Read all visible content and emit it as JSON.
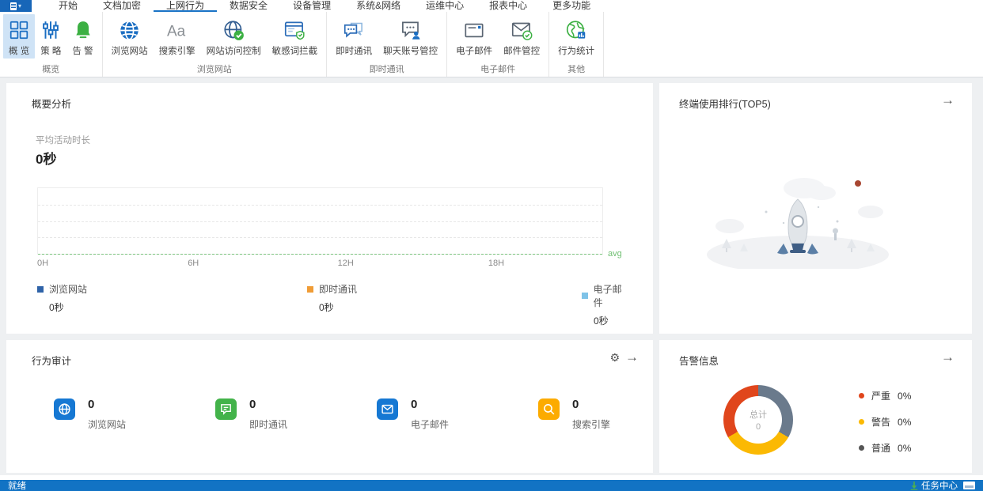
{
  "window": {
    "app_menu_caret": "▾",
    "tabs": {
      "items": [
        "开始",
        "文档加密",
        "上网行为",
        "数据安全",
        "设备管理",
        "系统&网络",
        "运维中心",
        "报表中心",
        "更多功能"
      ],
      "active": "上网行为"
    }
  },
  "ribbon": {
    "groups": [
      {
        "label": "概览",
        "items": [
          {
            "label": "概 览",
            "selected": true
          },
          {
            "label": "策 略"
          },
          {
            "label": "告 警"
          }
        ]
      },
      {
        "label": "浏览网站",
        "items": [
          {
            "label": "浏览网站"
          },
          {
            "label": "搜索引擎"
          },
          {
            "label": "网站访问控制"
          },
          {
            "label": "敏感词拦截"
          }
        ]
      },
      {
        "label": "即时通讯",
        "items": [
          {
            "label": "即时通讯"
          },
          {
            "label": "聊天账号管控"
          }
        ]
      },
      {
        "label": "电子邮件",
        "items": [
          {
            "label": "电子邮件"
          },
          {
            "label": "邮件管控"
          }
        ]
      },
      {
        "label": "其他",
        "items": [
          {
            "label": "行为统计"
          }
        ]
      }
    ]
  },
  "panels": {
    "summary": {
      "title": "概要分析",
      "metric_label": "平均活动时长",
      "metric_value": "0秒",
      "x_ticks": [
        "0H",
        "6H",
        "12H",
        "18H"
      ],
      "avg_label": "avg",
      "legend": [
        {
          "name": "浏览网站",
          "value": "0秒",
          "color": "#2f63a8"
        },
        {
          "name": "即时通讯",
          "value": "0秒",
          "color": "#f09c36"
        },
        {
          "name": "电子邮件",
          "value": "0秒",
          "color": "#7fc3e8"
        }
      ]
    },
    "terminal_rank": {
      "title": "终端使用排行(TOP5)"
    },
    "behavior_audit": {
      "title": "行为审计",
      "stats": [
        {
          "value": "0",
          "label": "浏览网站",
          "color": "#1678d3"
        },
        {
          "value": "0",
          "label": "即时通讯",
          "color": "#43b34a"
        },
        {
          "value": "0",
          "label": "电子邮件",
          "color": "#1678d3"
        },
        {
          "value": "0",
          "label": "搜索引擎",
          "color": "#fcab00"
        }
      ]
    },
    "alarm": {
      "title": "告警信息",
      "donut": {
        "center_label": "总计",
        "center_value": "0",
        "segments": [
          {
            "name": "严重",
            "pct": "0%",
            "color": "#e0461c"
          },
          {
            "name": "警告",
            "pct": "0%",
            "color": "#fbb903"
          },
          {
            "name": "普通",
            "pct": "0%",
            "color": "#6a7a8c"
          }
        ]
      }
    }
  },
  "statusbar": {
    "ready": "就绪",
    "task_center": "任务中心"
  },
  "chart_data": [
    {
      "type": "line",
      "title": "平均活动时长",
      "x_axis": {
        "tick_labels": [
          "0H",
          "6H",
          "12H",
          "18H"
        ],
        "range_hours": [
          0,
          24
        ]
      },
      "series": [
        {
          "name": "浏览网站",
          "values": [
            0
          ]
        },
        {
          "name": "即时通讯",
          "values": [
            0
          ]
        },
        {
          "name": "电子邮件",
          "values": [
            0
          ]
        }
      ],
      "annotations": [
        "avg"
      ],
      "note": "空图表：所有序列均为0秒"
    },
    {
      "type": "pie",
      "title": "告警信息",
      "center_label": "总计",
      "center_value": 0,
      "slices": [
        {
          "label": "严重",
          "value_pct": 0
        },
        {
          "label": "警告",
          "value_pct": 0
        },
        {
          "label": "普通",
          "value_pct": 0
        }
      ],
      "legend_position": "right"
    }
  ]
}
